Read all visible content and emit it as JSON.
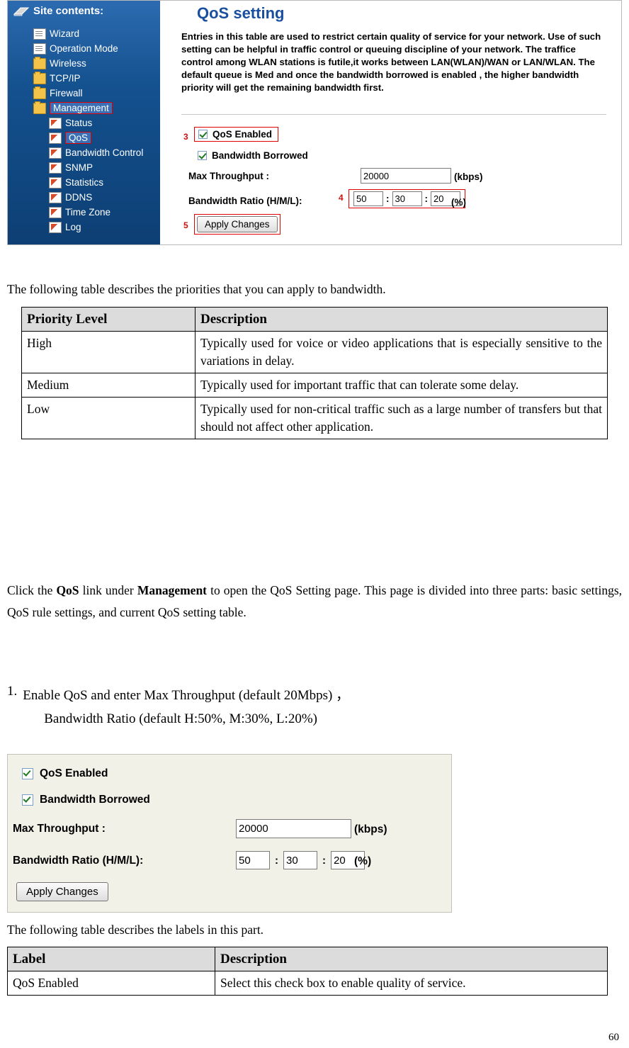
{
  "screenshot1": {
    "sidebar": {
      "title": "Site contents:",
      "items": [
        {
          "label": "Wizard",
          "icon": "page-icon",
          "level": 1,
          "highlight": false
        },
        {
          "label": "Operation Mode",
          "icon": "page-icon",
          "level": 1,
          "highlight": false
        },
        {
          "label": "Wireless",
          "icon": "folder-icon",
          "level": 1,
          "highlight": false
        },
        {
          "label": "TCP/IP",
          "icon": "folder-icon",
          "level": 1,
          "highlight": false
        },
        {
          "label": "Firewall",
          "icon": "folder-icon",
          "level": 1,
          "highlight": false
        },
        {
          "label": "Management",
          "icon": "folder-open-icon",
          "level": 1,
          "highlight": true
        },
        {
          "label": "Status",
          "icon": "page-icon",
          "level": 2,
          "highlight": false
        },
        {
          "label": "QoS",
          "icon": "page-icon",
          "level": 2,
          "highlight": true
        },
        {
          "label": "Bandwidth Control",
          "icon": "page-icon",
          "level": 2,
          "highlight": false
        },
        {
          "label": "SNMP",
          "icon": "page-icon",
          "level": 2,
          "highlight": false
        },
        {
          "label": "Statistics",
          "icon": "page-icon",
          "level": 2,
          "highlight": false
        },
        {
          "label": "DDNS",
          "icon": "page-icon",
          "level": 2,
          "highlight": false
        },
        {
          "label": "Time Zone",
          "icon": "page-icon",
          "level": 2,
          "highlight": false
        },
        {
          "label": "Log",
          "icon": "page-icon",
          "level": 2,
          "highlight": false
        }
      ]
    },
    "heading": "QoS setting",
    "description": "Entries in this table are used to restrict certain quality of service for your network. Use of such setting can be helpful in traffic control or queuing discipline of your network. The traffice control among WLAN stations is futile,it works between LAN(WLAN)/WAN or LAN/WLAN. The default queue is Med and once the bandwidth borrowed is enabled , the higher bandwidth priority will get the remaining bandwidth first.",
    "callouts": {
      "c3": "3",
      "c4": "4",
      "c5": "5"
    },
    "form": {
      "qos_enabled_label": "QoS Enabled",
      "qos_enabled_checked": true,
      "bandwidth_borrowed_label": "Bandwidth Borrowed",
      "bandwidth_borrowed_checked": true,
      "max_throughput_label": "Max Throughput :",
      "max_throughput_value": "20000",
      "kbps_unit": "(kbps)",
      "ratio_label": "Bandwidth Ratio (H/M/L):",
      "ratio_high": "50",
      "ratio_med": "30",
      "ratio_low": "20",
      "percent_unit": "(%)",
      "colon1": ":",
      "colon2": ":",
      "apply_button": "Apply Changes"
    }
  },
  "intro_text": "The following table describes the priorities that you can apply to bandwidth.",
  "priority_table": {
    "headers": [
      "Priority Level",
      "Description"
    ],
    "rows": [
      {
        "level": "High",
        "description": "Typically used for voice or video applications that is especially sensitive to the variations in delay."
      },
      {
        "level": "Medium",
        "description": "Typically used for important traffic that can tolerate some delay."
      },
      {
        "level": "Low",
        "description": "Typically used for non-critical traffic such as a large number of transfers but that should not affect other application."
      }
    ]
  },
  "paragraph": {
    "part1": "Click the ",
    "bold1": "QoS",
    "part2": " link under ",
    "bold2": "Management",
    "part3": " to open the QoS Setting page. This page is divided into three parts: basic settings, QoS rule settings, and current QoS setting table."
  },
  "step1": {
    "number": "1.",
    "text_a": "Enable QoS and enter Max Throughput (default 20Mbps) ，",
    "text_b": "Bandwidth Ratio (default H:50%, M:30%, L:20%)"
  },
  "screenshot2": {
    "qos_enabled_label": "QoS Enabled",
    "qos_enabled_checked": true,
    "bandwidth_borrowed_label": "Bandwidth Borrowed",
    "bandwidth_borrowed_checked": true,
    "max_throughput_label": "Max Throughput :",
    "max_throughput_value": "20000",
    "kbps_unit": "(kbps)",
    "ratio_label": "Bandwidth Ratio (H/M/L):",
    "ratio_high": "50",
    "ratio_med": "30",
    "ratio_low": "20",
    "percent_unit": "(%)",
    "colon1": ":",
    "colon2": ":",
    "apply_button": "Apply Changes"
  },
  "labels_intro": "The following table describes the labels in this part.",
  "labels_table": {
    "headers": [
      "Label",
      "Description"
    ],
    "rows": [
      {
        "label": "QoS Enabled",
        "description": "Select this check box to enable quality of service."
      }
    ]
  },
  "page_number": "60"
}
